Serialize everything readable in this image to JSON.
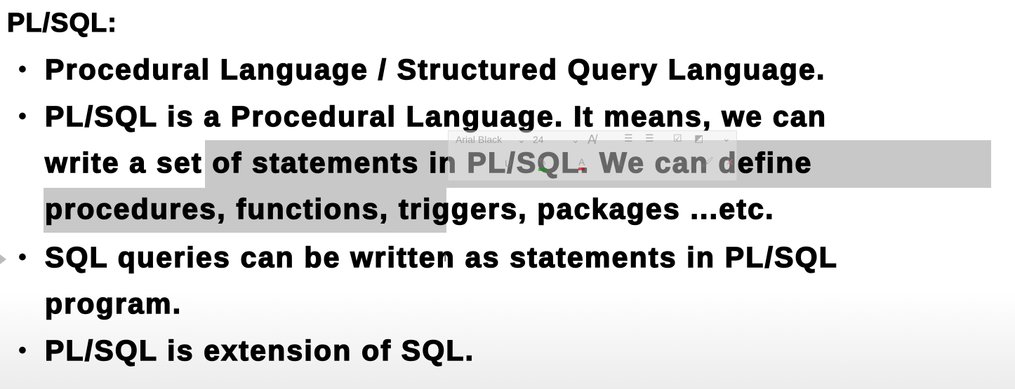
{
  "slide": {
    "title": "PL/SQL:",
    "bullets": [
      {
        "lines": [
          "Procedural Language / Structured Query Language."
        ]
      },
      {
        "lines": [
          "PL/SQL is a Procedural Language. It means, we can",
          "write a set of statements in PL/SQL. We can define",
          "procedures, functions, triggers, packages ...etc."
        ]
      },
      {
        "lines": [
          "SQL queries can be written as statements in PL/SQL",
          "program."
        ]
      },
      {
        "lines": [
          "PL/SQL is extension of SQL."
        ]
      }
    ],
    "bullet_char": "•"
  },
  "mini_toolbar": {
    "font_name": "Arial Black",
    "font_size": "24"
  },
  "colors": {
    "selection": "#c8c8c8"
  }
}
